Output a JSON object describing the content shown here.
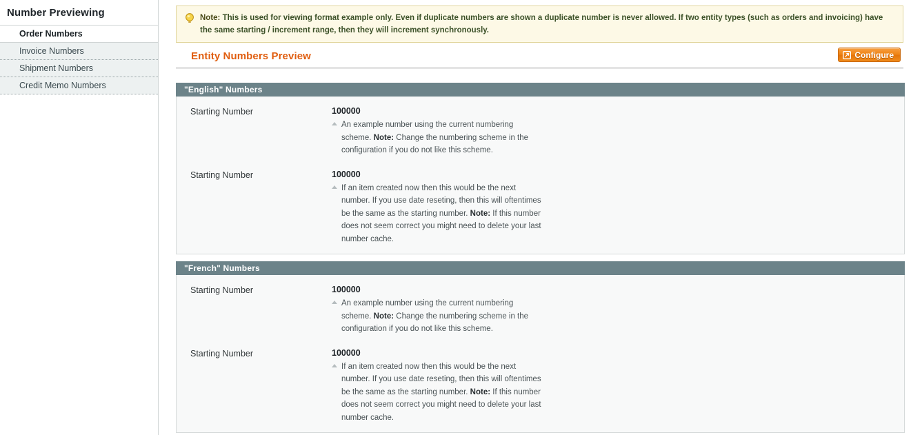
{
  "sidebar": {
    "title": "Number Previewing",
    "items": [
      {
        "label": "Order Numbers",
        "active": true
      },
      {
        "label": "Invoice Numbers",
        "active": false
      },
      {
        "label": "Shipment Numbers",
        "active": false
      },
      {
        "label": "Credit Memo Numbers",
        "active": false
      }
    ]
  },
  "note": {
    "icon": "lightbulb-icon",
    "label": "Note:",
    "text": " This is used for viewing format example only. Even if duplicate numbers are shown a duplicate number is never allowed. If two entity types (such as orders and invoicing) have the same starting / increment range, then they will increment synchronously."
  },
  "header": {
    "title": "Entity Numbers Preview",
    "configure_button": {
      "label": "Configure",
      "icon": "external-window-icon"
    }
  },
  "colors": {
    "accent_orange": "#e05e10",
    "panel_header": "#6c8389",
    "note_bg": "#fdf9e6",
    "note_border": "#e0d59b",
    "tab_green": "#6f8f3c"
  },
  "panels": [
    {
      "title": "\"English\" Numbers",
      "rows": [
        {
          "label": "Starting Number",
          "value": "100000",
          "hint_pre": "An example number using the current numbering scheme. ",
          "hint_bold": "Note:",
          "hint_post": " Change the numbering scheme in the configuration if you do not like this scheme."
        },
        {
          "label": "Starting Number",
          "value": "100000",
          "hint_pre": "If an item created now then this would be the next number. If you use date reseting, then this will oftentimes be the same as the starting number. ",
          "hint_bold": "Note:",
          "hint_post": " If this number does not seem correct you might need to delete your last number cache."
        }
      ]
    },
    {
      "title": "\"French\" Numbers",
      "rows": [
        {
          "label": "Starting Number",
          "value": "100000",
          "hint_pre": "An example number using the current numbering scheme. ",
          "hint_bold": "Note:",
          "hint_post": " Change the numbering scheme in the configuration if you do not like this scheme."
        },
        {
          "label": "Starting Number",
          "value": "100000",
          "hint_pre": "If an item created now then this would be the next number. If you use date reseting, then this will oftentimes be the same as the starting number. ",
          "hint_bold": "Note:",
          "hint_post": " If this number does not seem correct you might need to delete your last number cache."
        }
      ]
    }
  ]
}
